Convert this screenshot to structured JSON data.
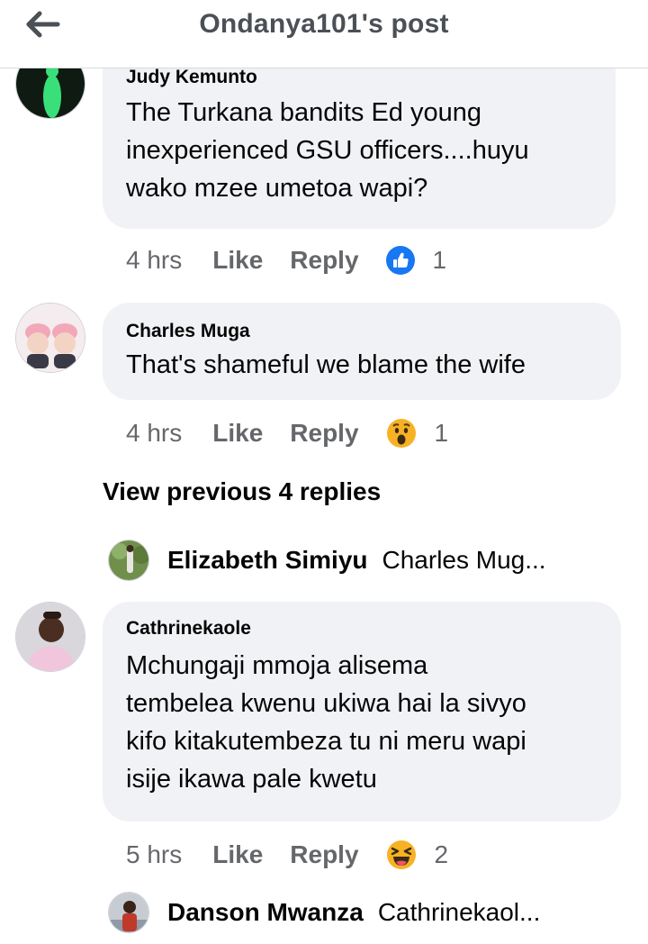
{
  "header": {
    "title": "Ondanya101's post"
  },
  "comments": [
    {
      "author": "Judy Kemunto",
      "lines": [
        "The Turkana bandits Ed young",
        "inexperienced GSU officers....huyu",
        "wako mzee umetoa wapi?"
      ],
      "time": "4 hrs",
      "like": "Like",
      "reply": "Reply",
      "reaction": "like-icon",
      "reaction_count": "1"
    },
    {
      "author": "Charles Muga",
      "lines": [
        "That's shameful we blame the wife"
      ],
      "time": "4 hrs",
      "like": "Like",
      "reply": "Reply",
      "reaction": "wow-icon",
      "reaction_count": "1"
    },
    {
      "author": "Cathrinekaole",
      "lines": [
        "Mchungaji mmoja alisema",
        "tembelea kwenu ukiwa hai la sivyo",
        "kifo kitakutembeza tu ni meru wapi",
        "isije ikawa pale kwetu"
      ],
      "time": "5 hrs",
      "like": "Like",
      "reply": "Reply",
      "reaction": "laugh-icon",
      "reaction_count": "2"
    }
  ],
  "view_previous": "View previous 4 replies",
  "replies": [
    {
      "author": "Elizabeth Simiyu",
      "preview": "Charles Mug..."
    },
    {
      "author": "Danson Mwanza",
      "preview": "Cathrinekaol..."
    }
  ],
  "colors": {
    "like_blue": "#1877f2",
    "bubble": "#f0f2f5",
    "muted": "#65676b"
  }
}
